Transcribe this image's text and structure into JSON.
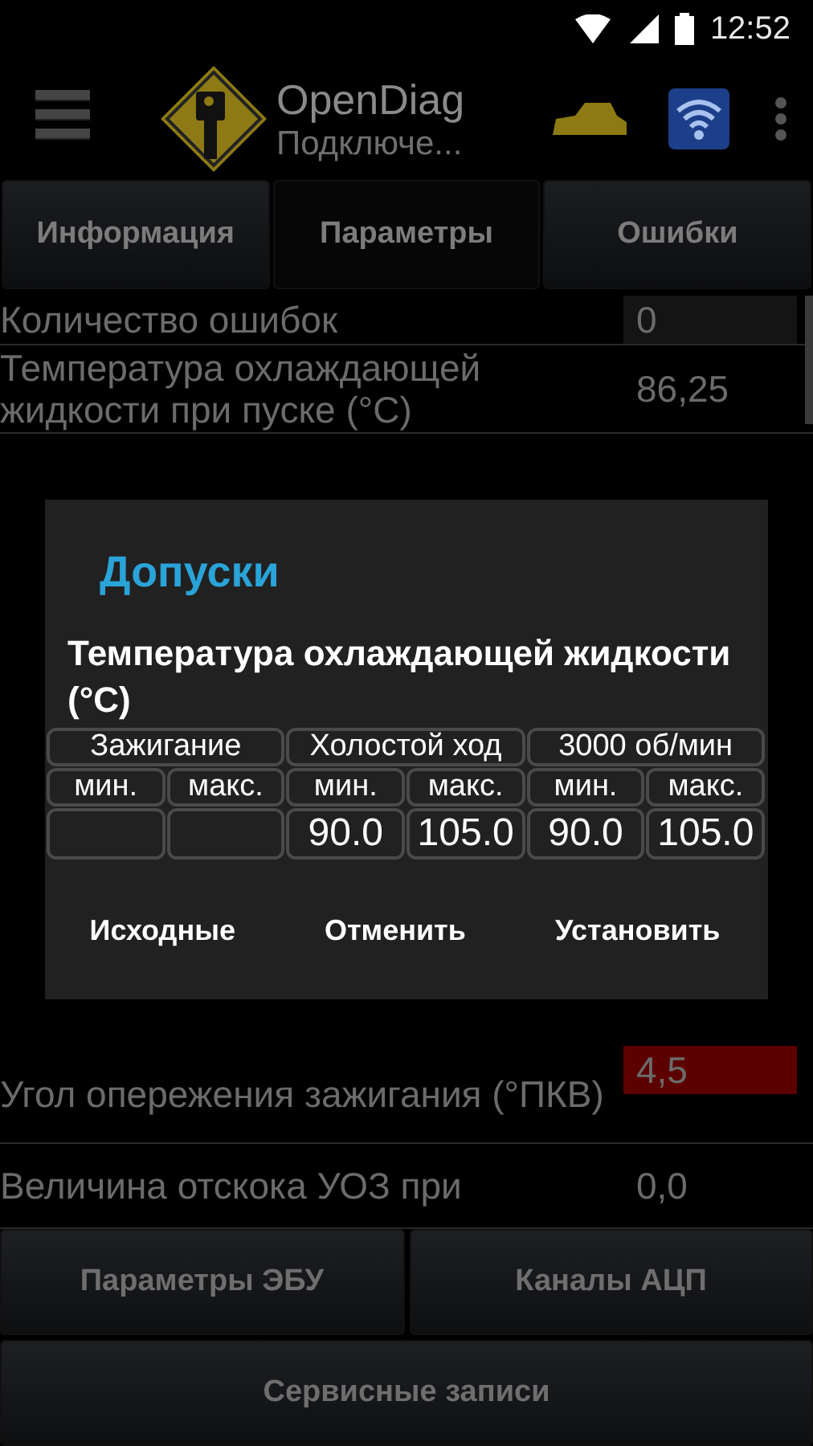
{
  "status_bar": {
    "time": "12:52"
  },
  "app_bar": {
    "title": "OpenDiag",
    "subtitle": "Подключе..."
  },
  "tabs": [
    {
      "label": "Информация",
      "selected": false
    },
    {
      "label": "Параметры",
      "selected": true
    },
    {
      "label": "Ошибки",
      "selected": false
    }
  ],
  "parameters": [
    {
      "name": "Количество ошибок",
      "value": "0",
      "alert": false
    },
    {
      "name": "Температура охлаждающей жидкости при пуске (°C)",
      "value": "86,25",
      "alert": false
    },
    {
      "name": "Угол опережения зажигания (°ПКВ)",
      "value": "4,5",
      "alert": true
    },
    {
      "name": "Величина отскока УОЗ при",
      "value": "0,0",
      "alert": false
    }
  ],
  "dialog": {
    "title": "Допуски",
    "parameter": "Температура охлаждающей жидкости (°C)",
    "groups": [
      {
        "label": "Зажигание",
        "columns": [
          {
            "label": "мин."
          },
          {
            "label": "макс."
          }
        ]
      },
      {
        "label": "Холостой ход",
        "columns": [
          {
            "label": "мин.",
            "value": "90.0"
          },
          {
            "label": "макс.",
            "value": "105.0"
          }
        ]
      },
      {
        "label": "3000 об/мин",
        "columns": [
          {
            "label": "мин.",
            "value": "90.0"
          },
          {
            "label": "макс.",
            "value": "105.0"
          }
        ]
      }
    ],
    "buttons": [
      "Исходные",
      "Отменить",
      "Установить"
    ]
  },
  "bottom_buttons": [
    "Параметры ЭБУ",
    "Каналы АЦП",
    "Сервисные записи"
  ]
}
